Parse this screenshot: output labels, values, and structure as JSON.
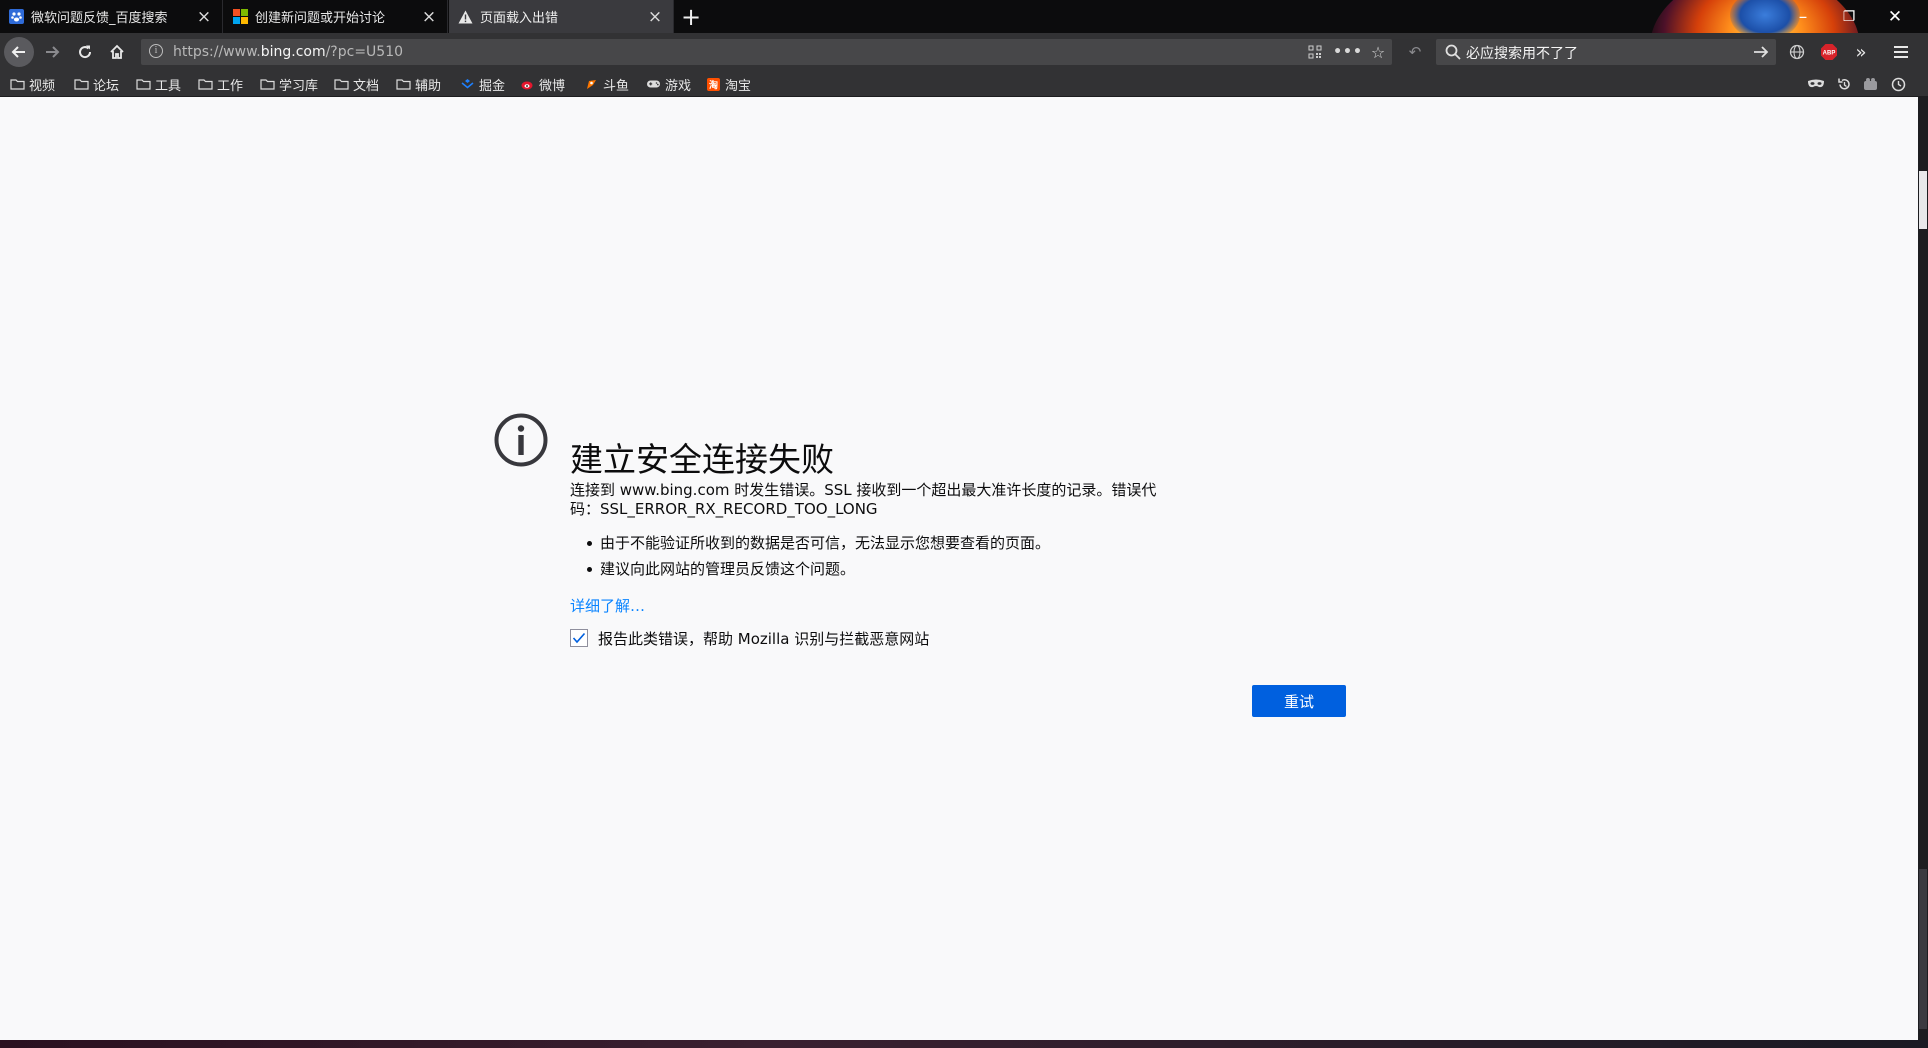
{
  "tabs": [
    {
      "title": "微软问题反馈_百度搜索",
      "favicon": "baidu-paw-icon",
      "active": false
    },
    {
      "title": "创建新问题或开始讨论",
      "favicon": "microsoft-logo-icon",
      "active": false
    },
    {
      "title": "页面载入出错",
      "favicon": "warning-icon",
      "active": true
    }
  ],
  "new_tab_label": "+",
  "window_controls": {
    "minimize": "–",
    "restore": "❐",
    "close": "✕"
  },
  "navbar": {
    "url_prefix": "https://www.",
    "url_host": "bing.com",
    "url_suffix": "/?pc=U510",
    "search_text": "必应搜索用不了了"
  },
  "bookmarks": [
    {
      "label": "视频",
      "icon": "folder-icon"
    },
    {
      "label": "论坛",
      "icon": "folder-icon"
    },
    {
      "label": "工具",
      "icon": "folder-icon"
    },
    {
      "label": "工作",
      "icon": "folder-icon"
    },
    {
      "label": "学习库",
      "icon": "folder-icon"
    },
    {
      "label": "文档",
      "icon": "folder-icon"
    },
    {
      "label": "辅助",
      "icon": "folder-icon"
    },
    {
      "label": "掘金",
      "icon": "juejin-icon"
    },
    {
      "label": "微博",
      "icon": "weibo-icon"
    },
    {
      "label": "斗鱼",
      "icon": "douyu-icon"
    },
    {
      "label": "游戏",
      "icon": "game-controller-icon"
    },
    {
      "label": "淘宝",
      "icon": "taobao-icon"
    }
  ],
  "error": {
    "title": "建立安全连接失败",
    "description": "连接到 www.bing.com 时发生错误。SSL 接收到一个超出最大准许长度的记录。错误代码：SSL_ERROR_RX_RECORD_TOO_LONG",
    "bullets": [
      "由于不能验证所收到的数据是否可信，无法显示您想要查看的页面。",
      "建议向此网站的管理员反馈这个问题。"
    ],
    "learn_more": "详细了解…",
    "report_label": "报告此类错误，帮助 Mozilla 识别与拦截恶意网站",
    "report_checked": true,
    "retry_label": "重试"
  },
  "colors": {
    "accent": "#0060df",
    "link": "#0a84ff",
    "page_bg": "#f9f9fa",
    "chrome": "#323234"
  }
}
